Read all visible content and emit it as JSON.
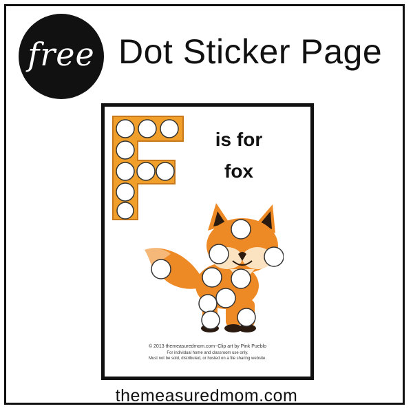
{
  "badge": {
    "word": "free"
  },
  "headline": "Dot Sticker Page",
  "worksheet": {
    "caption_line1": "is for",
    "caption_line2": "fox",
    "credit_line1": "© 2013 themeasuredmom.com~Clip art by Pink Pueblo",
    "credit_line2": "For individual home and classroom use only.",
    "credit_line3": "Must not be sold, distributed, or hosted on a file sharing website."
  },
  "footer": {
    "site": "themeasuredmom.com"
  },
  "colors": {
    "letter_orange": "#F0A02A",
    "fox_orange": "#EE8A25",
    "fox_light": "#F6B878",
    "fox_cream": "#FBE3C2",
    "fox_dark": "#2B1A10",
    "dot_fill": "#FFFFFF",
    "dot_stroke": "#333333"
  }
}
